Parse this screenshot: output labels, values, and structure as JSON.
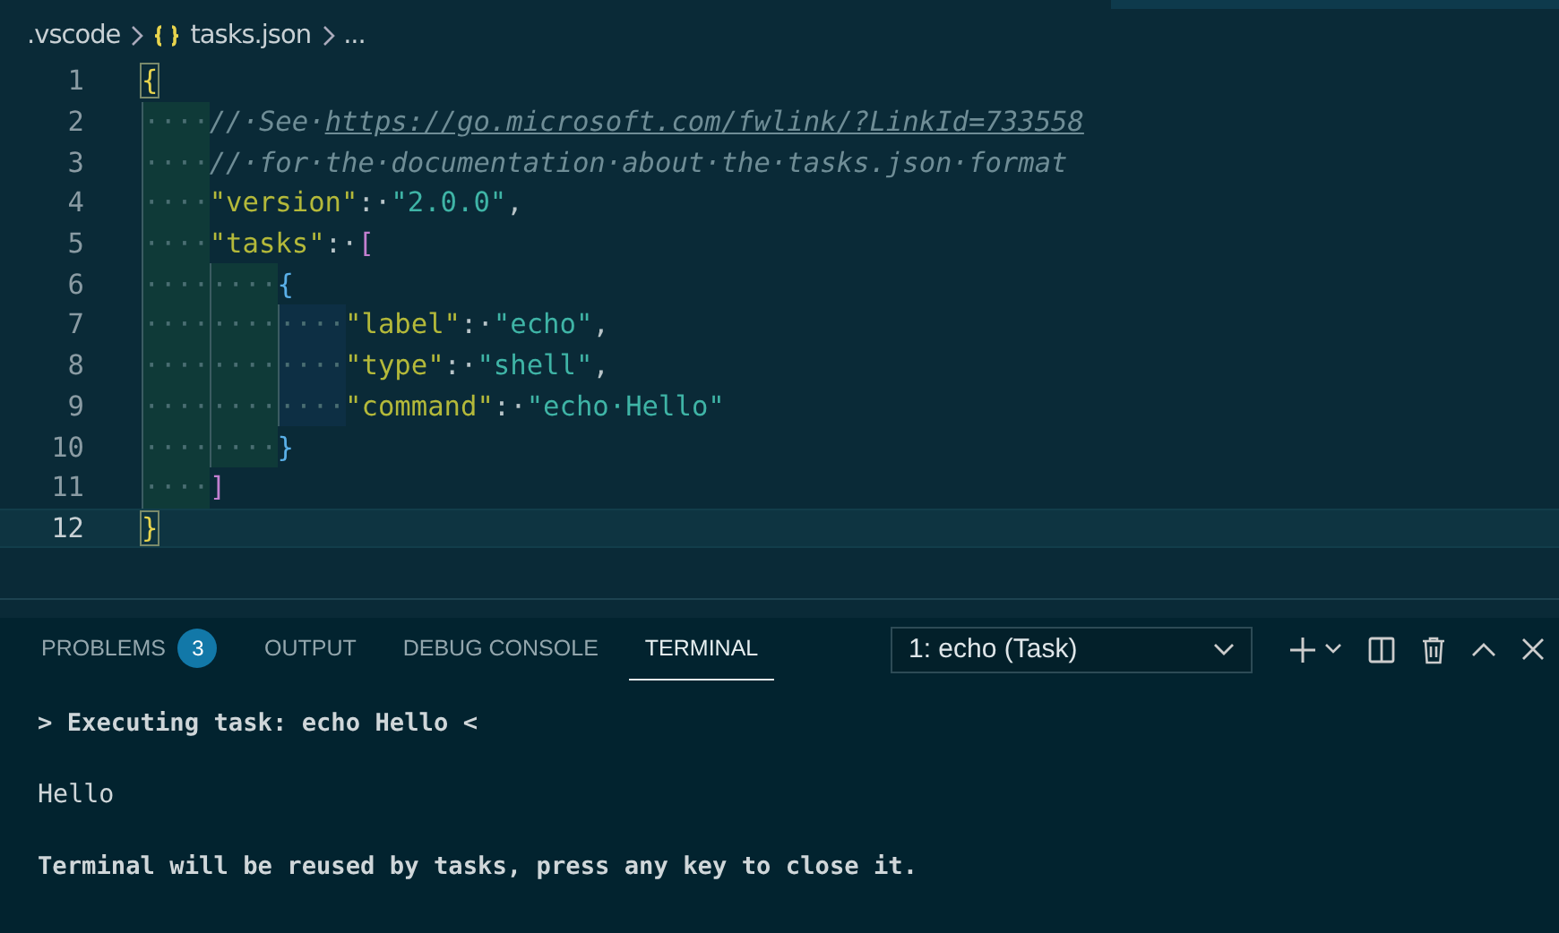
{
  "breadcrumb": [
    {
      "kind": "folder",
      "label": ".vscode"
    },
    {
      "kind": "json",
      "label": "tasks.json"
    },
    {
      "kind": "more",
      "label": "..."
    }
  ],
  "editor": {
    "lines": [
      {
        "number": "1",
        "current": false,
        "tokens": [
          {
            "kind": "bracket_match",
            "text": "{"
          }
        ]
      },
      {
        "number": "2",
        "current": false,
        "tokens": [
          {
            "kind": "indent",
            "text": "····"
          },
          {
            "kind": "comment",
            "text": "//·See·"
          },
          {
            "kind": "link",
            "text": "https://go.microsoft.com/fwlink/?LinkId=733558"
          }
        ]
      },
      {
        "number": "3",
        "current": false,
        "tokens": [
          {
            "kind": "indent",
            "text": "····"
          },
          {
            "kind": "comment",
            "text": "//·for·the·documentation·about·the·tasks.json·format"
          }
        ]
      },
      {
        "number": "4",
        "current": false,
        "tokens": [
          {
            "kind": "indent",
            "text": "····"
          },
          {
            "kind": "key",
            "text": "\"version\""
          },
          {
            "kind": "punct",
            "text": ":·"
          },
          {
            "kind": "string",
            "text": "\"2.0.0\""
          },
          {
            "kind": "punct",
            "text": ","
          }
        ]
      },
      {
        "number": "5",
        "current": false,
        "tokens": [
          {
            "kind": "indent",
            "text": "····"
          },
          {
            "kind": "key",
            "text": "\"tasks\""
          },
          {
            "kind": "punct",
            "text": ":·"
          },
          {
            "kind": "bracket2",
            "text": "["
          }
        ]
      },
      {
        "number": "6",
        "current": false,
        "tokens": [
          {
            "kind": "indent",
            "text": "····"
          },
          {
            "kind": "indent",
            "text": "····"
          },
          {
            "kind": "bracket3",
            "text": "{"
          }
        ]
      },
      {
        "number": "7",
        "current": false,
        "tokens": [
          {
            "kind": "indent",
            "text": "····"
          },
          {
            "kind": "indent",
            "text": "····"
          },
          {
            "kind": "indent",
            "text": "····"
          },
          {
            "kind": "key",
            "text": "\"label\""
          },
          {
            "kind": "punct",
            "text": ":·"
          },
          {
            "kind": "string",
            "text": "\"echo\""
          },
          {
            "kind": "punct",
            "text": ","
          }
        ]
      },
      {
        "number": "8",
        "current": false,
        "tokens": [
          {
            "kind": "indent",
            "text": "····"
          },
          {
            "kind": "indent",
            "text": "····"
          },
          {
            "kind": "indent",
            "text": "····"
          },
          {
            "kind": "key",
            "text": "\"type\""
          },
          {
            "kind": "punct",
            "text": ":·"
          },
          {
            "kind": "string",
            "text": "\"shell\""
          },
          {
            "kind": "punct",
            "text": ","
          }
        ]
      },
      {
        "number": "9",
        "current": false,
        "tokens": [
          {
            "kind": "indent",
            "text": "····"
          },
          {
            "kind": "indent",
            "text": "····"
          },
          {
            "kind": "indent",
            "text": "····"
          },
          {
            "kind": "key",
            "text": "\"command\""
          },
          {
            "kind": "punct",
            "text": ":·"
          },
          {
            "kind": "string",
            "text": "\"echo·Hello\""
          }
        ]
      },
      {
        "number": "10",
        "current": false,
        "tokens": [
          {
            "kind": "indent",
            "text": "····"
          },
          {
            "kind": "indent",
            "text": "····"
          },
          {
            "kind": "bracket3",
            "text": "}"
          }
        ]
      },
      {
        "number": "11",
        "current": false,
        "tokens": [
          {
            "kind": "indent",
            "text": "····"
          },
          {
            "kind": "bracket2",
            "text": "]"
          }
        ]
      },
      {
        "number": "12",
        "current": true,
        "tokens": [
          {
            "kind": "bracket_match",
            "text": "}"
          }
        ]
      }
    ]
  },
  "panel": {
    "tabs": [
      {
        "label": "PROBLEMS",
        "badge": "3",
        "selected": false
      },
      {
        "label": "OUTPUT",
        "selected": false
      },
      {
        "label": "DEBUG CONSOLE",
        "selected": false
      },
      {
        "label": "TERMINAL",
        "selected": true
      }
    ],
    "terminal_select": {
      "value": "1: echo (Task)"
    },
    "terminal": [
      {
        "kind": "bold",
        "text": "> Executing task: echo Hello <"
      },
      {
        "kind": "plain",
        "text": "Hello"
      },
      {
        "kind": "bold",
        "text": "Terminal will be reused by tasks, press any key to close it."
      }
    ]
  }
}
